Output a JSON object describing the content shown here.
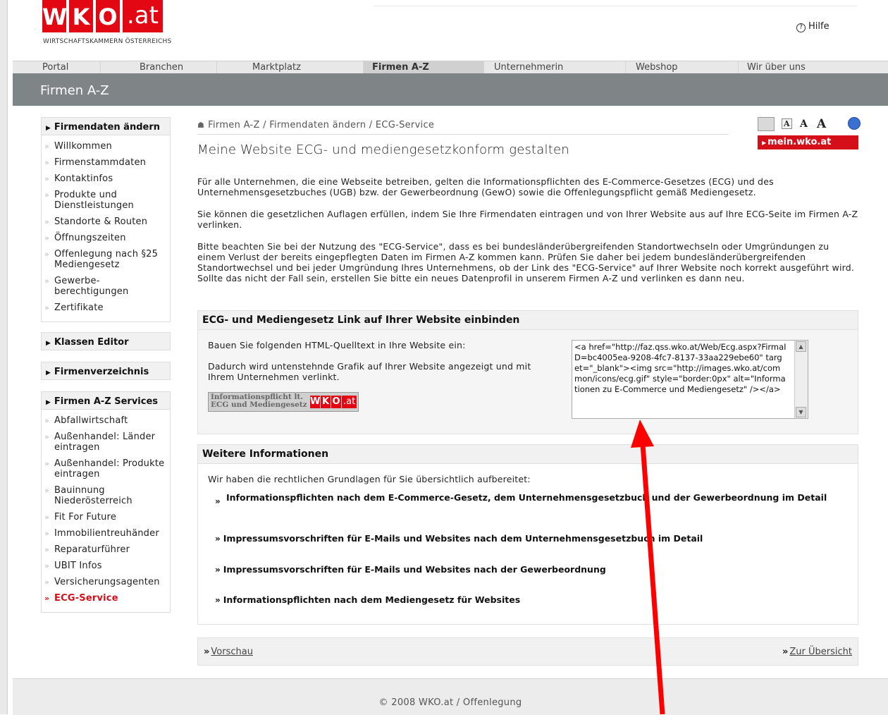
{
  "header": {
    "logo_letters": [
      "W",
      "K",
      "O"
    ],
    "logo_suffix": ".at",
    "logo_sub": "WIRTSCHAFTSKAMMERN ÖSTERREICHS",
    "help_label": "Hilfe"
  },
  "nav": {
    "tabs": [
      {
        "label": "Portal"
      },
      {
        "label": "Branchen"
      },
      {
        "label": "Marktplatz"
      },
      {
        "label": "Firmen A-Z"
      },
      {
        "label": "Unternehmerin"
      },
      {
        "label": "Webshop"
      },
      {
        "label": "Wir über uns"
      }
    ],
    "active_tab": "Firmen A-Z"
  },
  "band": {
    "title": "Firmen A-Z"
  },
  "sidebar": {
    "section1": {
      "title": "Firmendaten ändern",
      "items": [
        "Willkommen",
        "Firmenstammdaten",
        "Kontaktinfos",
        "Produkte und Dienstleistungen",
        "Standorte & Routen",
        "Öffnungszeiten",
        "Offenlegung nach §25 Mediengesetz",
        "Gewerbe-berechtigungen",
        "Zertifikate"
      ]
    },
    "section2": {
      "title": "Klassen Editor"
    },
    "section3": {
      "title": "Firmenverzeichnis"
    },
    "section4": {
      "title": "Firmen A-Z Services",
      "items": [
        "Abfallwirtschaft",
        "Außenhandel: Länder eintragen",
        "Außenhandel: Produkte eintragen",
        "Bauinnung Niederösterreich",
        "Fit For Future",
        "Immobilientreuhänder",
        "Reparaturführer",
        "UBIT Infos",
        "Versicherungsagenten",
        "ECG-Service"
      ],
      "active_item": "ECG-Service"
    }
  },
  "main": {
    "breadcrumb": "Firmen A-Z / Firmendaten ändern / ECG-Service",
    "mein_link": "mein.wko.at",
    "font_size_labels": [
      "A",
      "A",
      "A"
    ],
    "title": "Meine Website ECG- und mediengesetzkonform gestalten",
    "paragraphs": [
      "Für alle Unternehmen, die eine Webseite betreiben, gelten die Informationspflichten des E-Commerce-Gesetzes (ECG) und des Unternehmensgesetzbuches (UGB) bzw. der Gewerbeordnung (GewO) sowie die Offenlegungspflicht gemäß Mediengesetz.",
      "Sie können die gesetzlichen Auflagen erfüllen, indem Sie Ihre Firmendaten eintragen und von Ihrer Website aus auf Ihre ECG-Seite im Firmen A-Z verlinken.",
      "Bitte beachten Sie bei der Nutzung des \"ECG-Service\", dass es bei bundesländerübergreifenden Standortwechseln oder Umgründungen zu einem Verlust der bereits eingepflegten Daten im Firmen A-Z kommen kann. Prüfen Sie daher bei jedem bundesländerübergreifenden Standortwechsel und bei jeder Umgründung Ihres Unternehmens, ob der Link des \"ECG-Service\" auf Ihrer Website noch korrekt ausgeführt wird. Sollte das nicht der Fall sein, erstellen Sie bitte ein neues Datenprofil in unserem Firmen A-Z und verlinken es dann neu."
    ],
    "embed_box": {
      "title": "ECG- und Mediengesetz Link auf Ihrer Website einbinden",
      "instruction": "Bauen Sie folgenden HTML-Quelltext in Ihre Website ein:",
      "note": "Dadurch wird untenstehnde Grafik auf Ihrer Website angezeigt und mit Ihrem Unternehmen verlinkt.",
      "code": "<a href=\"http://faz.qss.wko.at/Web/Ecg.aspx?FirmaID=bc4005ea-9208-4fc7-8137-33aa229ebe60\" target=\"_blank\"><img src=\"http://images.wko.at/common/icons/ecg.gif\" style=\"border:0px\" alt=\"Informationen zu E-Commerce und Mediengesetz\" /></a>",
      "badge_line1": "Informationspflicht lt.",
      "badge_line2": "ECG und Mediengesetz",
      "badge_logo": [
        "W",
        "K",
        "O"
      ],
      "badge_suffix": ".at"
    },
    "info_box": {
      "title": "Weitere Informationen",
      "intro": "Wir haben die rechtlichen Grundlagen für Sie übersichtlich aufbereitet:",
      "links": [
        "Informationspflichten nach dem E-Commerce-Gesetz, dem Unternehmensgesetzbuch und der Gewerbeordnung im Detail",
        "Impressumsvorschriften für E-Mails und Websites nach dem Unternehmensgesetzbuch im Detail",
        "Impressumsvorschriften für E-Mails und Websites nach der Gewerbeordnung",
        "Informationspflichten nach dem Mediengesetz für Websites"
      ]
    },
    "bottom": {
      "preview": "Vorschau",
      "overview": "Zur Übersicht"
    }
  },
  "footer": {
    "text": "© 2008 WKO.at / Offenlegung"
  },
  "colors": {
    "brand_red": "#e30613",
    "band_gray": "#7f8586",
    "annotation_arrow": "#ff0000"
  }
}
